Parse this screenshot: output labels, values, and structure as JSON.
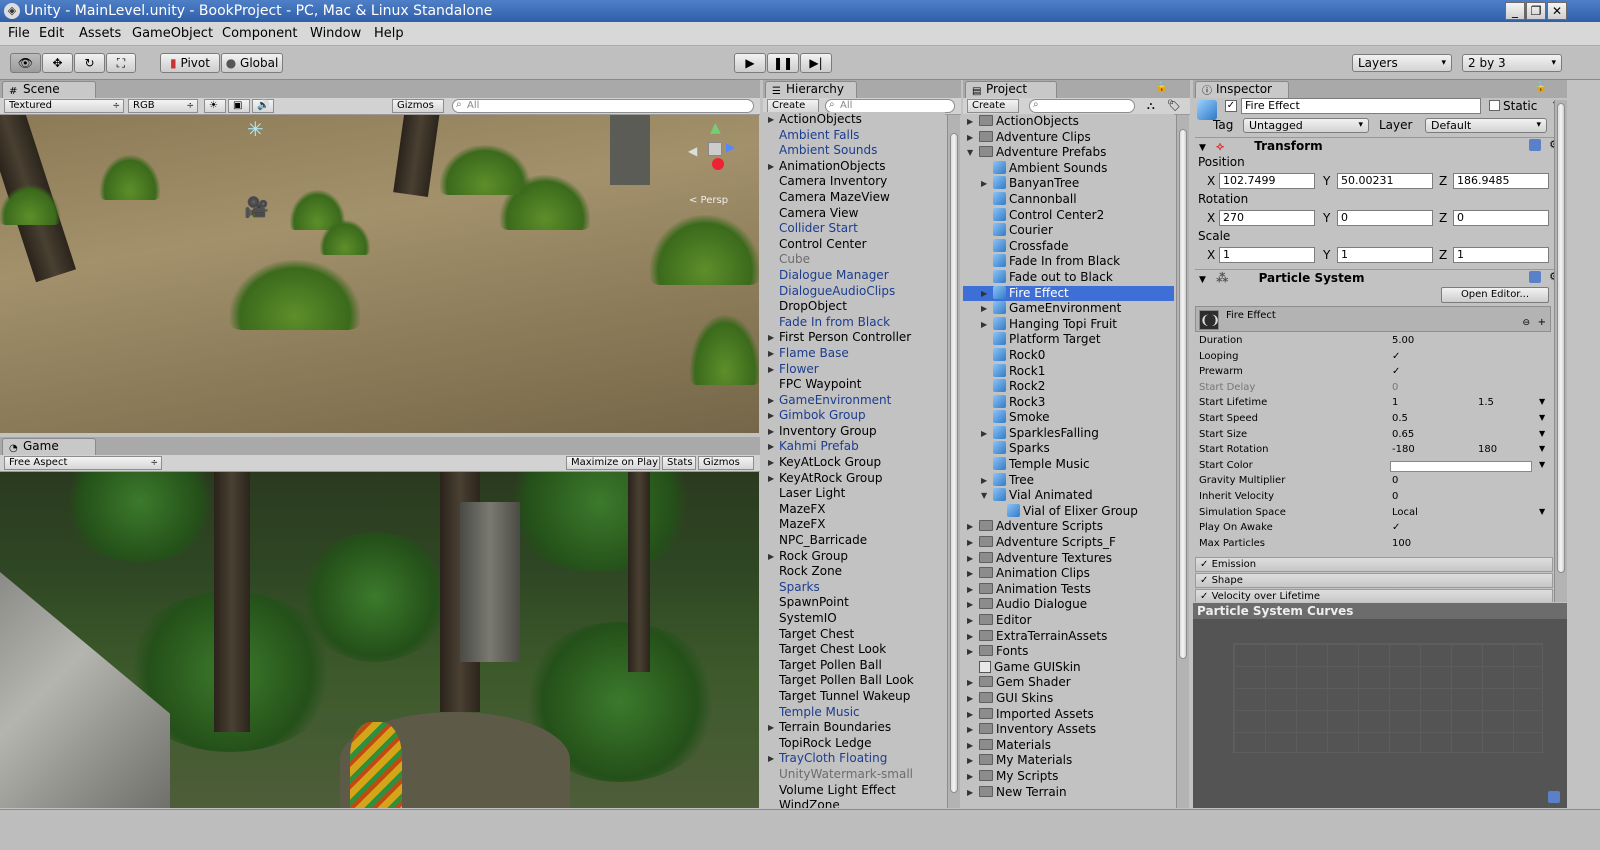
{
  "window": {
    "title": "Unity - MainLevel.unity - BookProject - PC, Mac & Linux Standalone"
  },
  "menu": [
    "File",
    "Edit",
    "Assets",
    "GameObject",
    "Component",
    "Window",
    "Help"
  ],
  "toolbar": {
    "pivot_label": "Pivot",
    "global_label": "Global",
    "layers_label": "Layers",
    "layout_label": "2 by 3"
  },
  "scene": {
    "tab_label": "Scene",
    "draw_mode": "Textured",
    "render_mode": "RGB",
    "gizmos_label": "Gizmos",
    "search_placeholder": "All"
  },
  "game": {
    "tab_label": "Game",
    "aspect_label": "Free Aspect",
    "maximize_label": "Maximize on Play",
    "stats_label": "Stats",
    "gizmos_label": "Gizmos"
  },
  "hierarchy": {
    "tab_label": "Hierarchy",
    "create_label": "Create",
    "search_placeholder": "All",
    "items": [
      {
        "label": "ActionObjects",
        "fold": true,
        "style": ""
      },
      {
        "label": "Ambient Falls",
        "fold": false,
        "style": "prefab"
      },
      {
        "label": "Ambient Sounds",
        "fold": false,
        "style": "prefab"
      },
      {
        "label": "AnimationObjects",
        "fold": true,
        "style": ""
      },
      {
        "label": "Camera Inventory",
        "fold": false,
        "style": ""
      },
      {
        "label": "Camera MazeView",
        "fold": false,
        "style": ""
      },
      {
        "label": "Camera View",
        "fold": false,
        "style": ""
      },
      {
        "label": "Collider Start",
        "fold": false,
        "style": "prefab"
      },
      {
        "label": "Control Center",
        "fold": false,
        "style": ""
      },
      {
        "label": "Cube",
        "fold": false,
        "style": "dim"
      },
      {
        "label": "Dialogue Manager",
        "fold": false,
        "style": "prefab"
      },
      {
        "label": "DialogueAudioClips",
        "fold": false,
        "style": "prefab"
      },
      {
        "label": "DropObject",
        "fold": false,
        "style": ""
      },
      {
        "label": "Fade In from Black",
        "fold": false,
        "style": "prefab"
      },
      {
        "label": "First Person Controller",
        "fold": true,
        "style": ""
      },
      {
        "label": "Flame Base",
        "fold": true,
        "style": "prefab"
      },
      {
        "label": "Flower",
        "fold": true,
        "style": "prefab"
      },
      {
        "label": "FPC Waypoint",
        "fold": false,
        "style": ""
      },
      {
        "label": "GameEnvironment",
        "fold": true,
        "style": "prefab"
      },
      {
        "label": "Gimbok Group",
        "fold": true,
        "style": "prefab"
      },
      {
        "label": "Inventory Group",
        "fold": true,
        "style": ""
      },
      {
        "label": "Kahmi Prefab",
        "fold": true,
        "style": "prefab"
      },
      {
        "label": "KeyAtLock Group",
        "fold": true,
        "style": ""
      },
      {
        "label": "KeyAtRock Group",
        "fold": true,
        "style": ""
      },
      {
        "label": "Laser Light",
        "fold": false,
        "style": ""
      },
      {
        "label": "MazeFX",
        "fold": false,
        "style": ""
      },
      {
        "label": "MazeFX",
        "fold": false,
        "style": ""
      },
      {
        "label": "NPC_Barricade",
        "fold": false,
        "style": ""
      },
      {
        "label": "Rock Group",
        "fold": true,
        "style": ""
      },
      {
        "label": "Rock Zone",
        "fold": false,
        "style": ""
      },
      {
        "label": "Sparks",
        "fold": false,
        "style": "prefab"
      },
      {
        "label": "SpawnPoint",
        "fold": false,
        "style": ""
      },
      {
        "label": "SystemIO",
        "fold": false,
        "style": ""
      },
      {
        "label": "Target Chest",
        "fold": false,
        "style": ""
      },
      {
        "label": "Target Chest Look",
        "fold": false,
        "style": ""
      },
      {
        "label": "Target Pollen Ball",
        "fold": false,
        "style": ""
      },
      {
        "label": "Target Pollen Ball Look",
        "fold": false,
        "style": ""
      },
      {
        "label": "Target Tunnel Wakeup",
        "fold": false,
        "style": ""
      },
      {
        "label": "Temple Music",
        "fold": false,
        "style": "prefab"
      },
      {
        "label": "Terrain Boundaries",
        "fold": true,
        "style": ""
      },
      {
        "label": "TopiRock Ledge",
        "fold": false,
        "style": ""
      },
      {
        "label": "TrayCloth Floating",
        "fold": true,
        "style": "prefab"
      },
      {
        "label": "UnityWatermark-small",
        "fold": false,
        "style": "dim"
      },
      {
        "label": "Volume Light Effect",
        "fold": false,
        "style": ""
      },
      {
        "label": "WindZone",
        "fold": false,
        "style": ""
      }
    ]
  },
  "project": {
    "tab_label": "Project",
    "create_label": "Create",
    "search_placeholder": "",
    "items": [
      {
        "label": "ActionObjects",
        "indent": 0,
        "fold": "closed",
        "icon": "folder",
        "selected": false
      },
      {
        "label": "Adventure Clips",
        "indent": 0,
        "fold": "closed",
        "icon": "folder",
        "selected": false
      },
      {
        "label": "Adventure Prefabs",
        "indent": 0,
        "fold": "open",
        "icon": "folder",
        "selected": false
      },
      {
        "label": "Ambient Sounds",
        "indent": 1,
        "fold": "none",
        "icon": "prefab",
        "selected": false
      },
      {
        "label": "BanyanTree",
        "indent": 1,
        "fold": "closed",
        "icon": "prefab",
        "selected": false
      },
      {
        "label": "Cannonball",
        "indent": 1,
        "fold": "none",
        "icon": "prefab",
        "selected": false
      },
      {
        "label": "Control Center2",
        "indent": 1,
        "fold": "none",
        "icon": "prefab",
        "selected": false
      },
      {
        "label": "Courier",
        "indent": 1,
        "fold": "none",
        "icon": "prefab",
        "selected": false
      },
      {
        "label": "Crossfade",
        "indent": 1,
        "fold": "none",
        "icon": "prefab",
        "selected": false
      },
      {
        "label": "Fade In from Black",
        "indent": 1,
        "fold": "none",
        "icon": "prefab",
        "selected": false
      },
      {
        "label": "Fade out to Black",
        "indent": 1,
        "fold": "none",
        "icon": "prefab",
        "selected": false
      },
      {
        "label": "Fire Effect",
        "indent": 1,
        "fold": "closed",
        "icon": "prefab",
        "selected": true
      },
      {
        "label": "GameEnvironment",
        "indent": 1,
        "fold": "closed",
        "icon": "prefab",
        "selected": false
      },
      {
        "label": "Hanging Topi Fruit",
        "indent": 1,
        "fold": "closed",
        "icon": "prefab",
        "selected": false
      },
      {
        "label": "Platform Target",
        "indent": 1,
        "fold": "none",
        "icon": "prefab",
        "selected": false
      },
      {
        "label": "Rock0",
        "indent": 1,
        "fold": "none",
        "icon": "prefab",
        "selected": false
      },
      {
        "label": "Rock1",
        "indent": 1,
        "fold": "none",
        "icon": "prefab",
        "selected": false
      },
      {
        "label": "Rock2",
        "indent": 1,
        "fold": "none",
        "icon": "prefab",
        "selected": false
      },
      {
        "label": "Rock3",
        "indent": 1,
        "fold": "none",
        "icon": "prefab",
        "selected": false
      },
      {
        "label": "Smoke",
        "indent": 1,
        "fold": "none",
        "icon": "prefab",
        "selected": false
      },
      {
        "label": "SparklesFalling",
        "indent": 1,
        "fold": "closed",
        "icon": "prefab",
        "selected": false
      },
      {
        "label": "Sparks",
        "indent": 1,
        "fold": "none",
        "icon": "prefab",
        "selected": false
      },
      {
        "label": "Temple Music",
        "indent": 1,
        "fold": "none",
        "icon": "prefab",
        "selected": false
      },
      {
        "label": "Tree",
        "indent": 1,
        "fold": "closed",
        "icon": "prefab",
        "selected": false
      },
      {
        "label": "Vial Animated",
        "indent": 1,
        "fold": "open",
        "icon": "prefab",
        "selected": false
      },
      {
        "label": "Vial of Elixer Group",
        "indent": 2,
        "fold": "none",
        "icon": "prefab",
        "selected": false
      },
      {
        "label": "Adventure Scripts",
        "indent": 0,
        "fold": "closed",
        "icon": "folder",
        "selected": false
      },
      {
        "label": "Adventure Scripts_F",
        "indent": 0,
        "fold": "closed",
        "icon": "folder",
        "selected": false
      },
      {
        "label": "Adventure Textures",
        "indent": 0,
        "fold": "closed",
        "icon": "folder",
        "selected": false
      },
      {
        "label": "Animation Clips",
        "indent": 0,
        "fold": "closed",
        "icon": "folder",
        "selected": false
      },
      {
        "label": "Animation Tests",
        "indent": 0,
        "fold": "closed",
        "icon": "folder",
        "selected": false
      },
      {
        "label": "Audio Dialogue",
        "indent": 0,
        "fold": "closed",
        "icon": "folder",
        "selected": false
      },
      {
        "label": "Editor",
        "indent": 0,
        "fold": "closed",
        "icon": "folder",
        "selected": false
      },
      {
        "label": "ExtraTerrainAssets",
        "indent": 0,
        "fold": "closed",
        "icon": "folder",
        "selected": false
      },
      {
        "label": "Fonts",
        "indent": 0,
        "fold": "closed",
        "icon": "folder",
        "selected": false
      },
      {
        "label": "Game GUISkin",
        "indent": 0,
        "fold": "none",
        "icon": "guiskin",
        "selected": false
      },
      {
        "label": "Gem Shader",
        "indent": 0,
        "fold": "closed",
        "icon": "folder",
        "selected": false
      },
      {
        "label": "GUI Skins",
        "indent": 0,
        "fold": "closed",
        "icon": "folder",
        "selected": false
      },
      {
        "label": "Imported Assets",
        "indent": 0,
        "fold": "closed",
        "icon": "folder",
        "selected": false
      },
      {
        "label": "Inventory Assets",
        "indent": 0,
        "fold": "closed",
        "icon": "folder",
        "selected": false
      },
      {
        "label": "Materials",
        "indent": 0,
        "fold": "closed",
        "icon": "folder",
        "selected": false
      },
      {
        "label": "My Materials",
        "indent": 0,
        "fold": "closed",
        "icon": "folder",
        "selected": false
      },
      {
        "label": "My Scripts",
        "indent": 0,
        "fold": "closed",
        "icon": "folder",
        "selected": false
      },
      {
        "label": "New Terrain",
        "indent": 0,
        "fold": "closed",
        "icon": "folder",
        "selected": false
      }
    ]
  },
  "inspector": {
    "tab_label": "Inspector",
    "object_name": "Fire Effect",
    "static_label": "Static",
    "tag_label": "Tag",
    "tag_value": "Untagged",
    "layer_label": "Layer",
    "layer_value": "Default",
    "transform": {
      "title": "Transform",
      "position_label": "Position",
      "rotation_label": "Rotation",
      "scale_label": "Scale",
      "position": {
        "x": "102.7499",
        "y": "50.00231",
        "z": "186.9485"
      },
      "rotation": {
        "x": "270",
        "y": "0",
        "z": "0"
      },
      "scale": {
        "x": "1",
        "y": "1",
        "z": "1"
      }
    },
    "particle_system": {
      "title": "Particle System",
      "open_editor_label": "Open Editor...",
      "effect_name": "Fire Effect",
      "props": [
        {
          "label": "Duration",
          "value": "5.00",
          "value2": "",
          "dim": false,
          "dropdown": false
        },
        {
          "label": "Looping",
          "value": "✓",
          "value2": "",
          "dim": false,
          "dropdown": false
        },
        {
          "label": "Prewarm",
          "value": "✓",
          "value2": "",
          "dim": false,
          "dropdown": false
        },
        {
          "label": "Start Delay",
          "value": "0",
          "value2": "",
          "dim": true,
          "dropdown": false
        },
        {
          "label": "Start Lifetime",
          "value": "1",
          "value2": "1.5",
          "dim": false,
          "dropdown": true
        },
        {
          "label": "Start Speed",
          "value": "0.5",
          "value2": "",
          "dim": false,
          "dropdown": true
        },
        {
          "label": "Start Size",
          "value": "0.65",
          "value2": "",
          "dim": false,
          "dropdown": true
        },
        {
          "label": "Start Rotation",
          "value": "-180",
          "value2": "180",
          "dim": false,
          "dropdown": true
        },
        {
          "label": "Start Color",
          "value": "",
          "value2": "",
          "dim": false,
          "dropdown": true
        },
        {
          "label": "Gravity Multiplier",
          "value": "0",
          "value2": "",
          "dim": false,
          "dropdown": false
        },
        {
          "label": "Inherit Velocity",
          "value": "0",
          "value2": "",
          "dim": false,
          "dropdown": false
        },
        {
          "label": "Simulation Space",
          "value": "Local",
          "value2": "",
          "dim": false,
          "dropdown": true
        },
        {
          "label": "Play On Awake",
          "value": "✓",
          "value2": "",
          "dim": false,
          "dropdown": false
        },
        {
          "label": "Max Particles",
          "value": "100",
          "value2": "",
          "dim": false,
          "dropdown": false
        }
      ],
      "modules": [
        "Emission",
        "Shape",
        "Velocity over Lifetime"
      ]
    },
    "curves_title": "Particle System Curves"
  },
  "scene_overlay": {
    "persp_label": "< Persp"
  }
}
